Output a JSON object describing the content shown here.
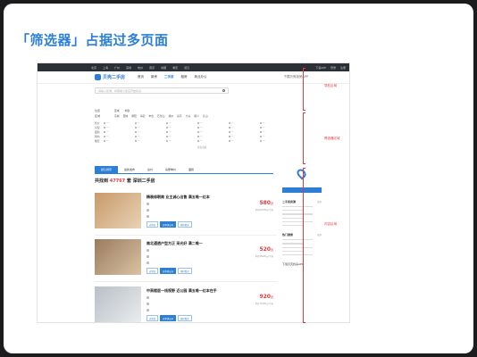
{
  "slide": {
    "title": "「筛选器」占据过多页面"
  },
  "topbar": {
    "left_items": [
      "北京",
      "上海",
      "广州",
      "深圳",
      "杭州",
      "南京",
      "成都",
      "重庆",
      "武汉"
    ],
    "right_items": [
      "下载APP",
      "登录",
      "注册"
    ]
  },
  "header": {
    "logo": "贝壳二手房",
    "nav": [
      "首页",
      "新房",
      "二手房",
      "租房",
      "商业办公"
    ],
    "right": "下载贝壳找房APP"
  },
  "search": {
    "placeholder": "请输入区域、商圈或小区名开始找房"
  },
  "filter": {
    "row1_label": "位置",
    "row1_options": [
      "区域",
      "地铁"
    ],
    "row2_label": "区域",
    "row2_options": [
      "东城",
      "西城",
      "朝阳",
      "海淀",
      "丰台",
      "石景山",
      "通州",
      "昌平",
      "大兴",
      "顺义",
      "房山"
    ],
    "grid_labels": [
      "售价",
      "房型",
      "面积",
      "朝向",
      "楼层"
    ],
    "grid_columns": 6,
    "more": "更多选项"
  },
  "tabs": [
    "默认排序",
    "最新发布",
    "总价",
    "房屋单价",
    "面积"
  ],
  "count": {
    "prefix": "共找到",
    "number": "47767",
    "suffix": "套 深圳二手房"
  },
  "listings": [
    {
      "title": "精装修朝南 业主诚心出售 满五唯一红本",
      "price": "580",
      "price_unit": "万",
      "unit_price": "单价62000元/平米",
      "tags": [
        "近地铁",
        "房本满五年",
        "随时看房"
      ]
    },
    {
      "title": "南北通透户型方正 采光好 满二唯一",
      "price": "520",
      "price_unit": "万",
      "unit_price": "单价58000元/平米",
      "tags": [
        "近地铁",
        "房本满五年",
        "随时看房"
      ]
    },
    {
      "title": "中高楼层一线视野 近公园 满五唯一红本在手",
      "price": "920",
      "price_unit": "万",
      "unit_price": "单价71000元/平米",
      "tags": [
        "近地铁",
        "房本满五年",
        "随时看房"
      ]
    }
  ],
  "side": {
    "section1": "二手房房源",
    "section2": "热门搜索",
    "more": "更多",
    "app": "下载贝壳找房APP"
  },
  "annotations": [
    "导航区域",
    "筛选器区域",
    "内容区域"
  ],
  "colors": {
    "accent": "#2d7fd6",
    "price": "#e5393f",
    "annotation": "#e5393f"
  }
}
